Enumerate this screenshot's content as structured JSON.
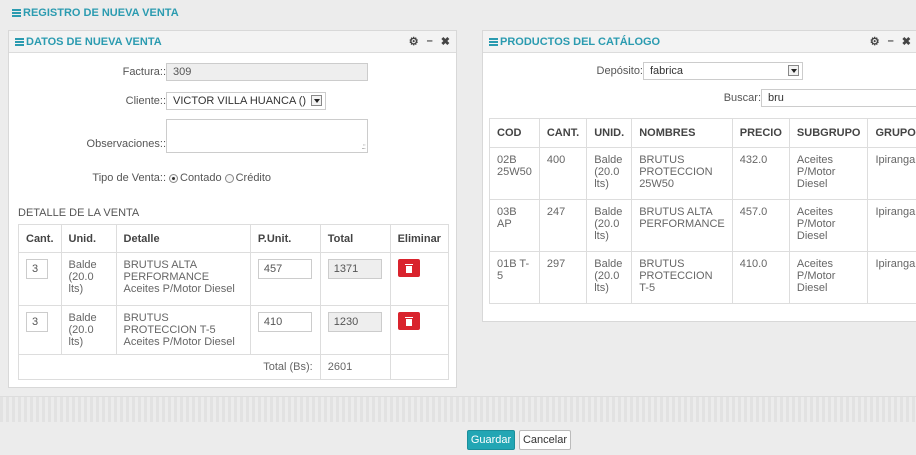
{
  "page_title": "REGISTRO DE NUEVA VENTA",
  "colors": {
    "accent": "#2b9bb0",
    "danger": "#d9232d",
    "primary_button": "#22a6b4"
  },
  "left_panel": {
    "title": "DATOS DE NUEVA VENTA",
    "tools": {
      "gear": "⚙",
      "minimize": "–",
      "close": "✖"
    },
    "factura": {
      "label": "Factura::",
      "value": "309"
    },
    "cliente": {
      "label": "Cliente::",
      "value": "VICTOR VILLA HUANCA ()"
    },
    "observaciones": {
      "label": "Observaciones::",
      "value": ""
    },
    "tipo_venta": {
      "label": "Tipo de Venta::",
      "options": [
        "Contado",
        "Crédito"
      ],
      "selected": "Contado"
    },
    "detalle_title": "DETALLE DE LA VENTA",
    "detail_table": {
      "headers": [
        "Cant.",
        "Unid.",
        "Detalle",
        "P.Unit.",
        "Total",
        "Eliminar"
      ],
      "rows": [
        {
          "cant": "3",
          "unid": "Balde (20.0 lts)",
          "detalle": "BRUTUS ALTA PERFORMANCE Aceites P/Motor Diesel",
          "punit": "457",
          "total": "1371"
        },
        {
          "cant": "3",
          "unid": "Balde (20.0 lts)",
          "detalle": "BRUTUS PROTECCION T-5 Aceites P/Motor Diesel",
          "punit": "410",
          "total": "1230"
        }
      ],
      "total_label": "Total (Bs):",
      "total_value": "2601"
    }
  },
  "right_panel": {
    "title": "PRODUCTOS DEL CATÁLOGO",
    "tools": {
      "gear": "⚙",
      "minimize": "–",
      "close": "✖"
    },
    "deposito": {
      "label": "Depósito:",
      "value": "fabrica"
    },
    "buscar": {
      "label": "Buscar:",
      "value": "bru"
    },
    "catalog_table": {
      "headers": [
        "COD",
        "CANT.",
        "UNID.",
        "NOMBRES",
        "PRECIO",
        "SUBGRUPO",
        "GRUPO"
      ],
      "rows": [
        {
          "cod": "02B 25W50",
          "cant": "400",
          "unid": "Balde (20.0 lts)",
          "nombre": "BRUTUS PROTECCION 25W50",
          "precio": "432.0",
          "subgrupo": "Aceites P/Motor Diesel",
          "grupo": "Ipiranga"
        },
        {
          "cod": "03B AP",
          "cant": "247",
          "unid": "Balde (20.0 lts)",
          "nombre": "BRUTUS ALTA PERFORMANCE",
          "precio": "457.0",
          "subgrupo": "Aceites P/Motor Diesel",
          "grupo": "Ipiranga"
        },
        {
          "cod": "01B T-5",
          "cant": "297",
          "unid": "Balde (20.0 lts)",
          "nombre": "BRUTUS PROTECCION T-5",
          "precio": "410.0",
          "subgrupo": "Aceites P/Motor Diesel",
          "grupo": "Ipiranga"
        }
      ]
    }
  },
  "footer": {
    "save_label": "Guardar",
    "cancel_label": "Cancelar"
  }
}
